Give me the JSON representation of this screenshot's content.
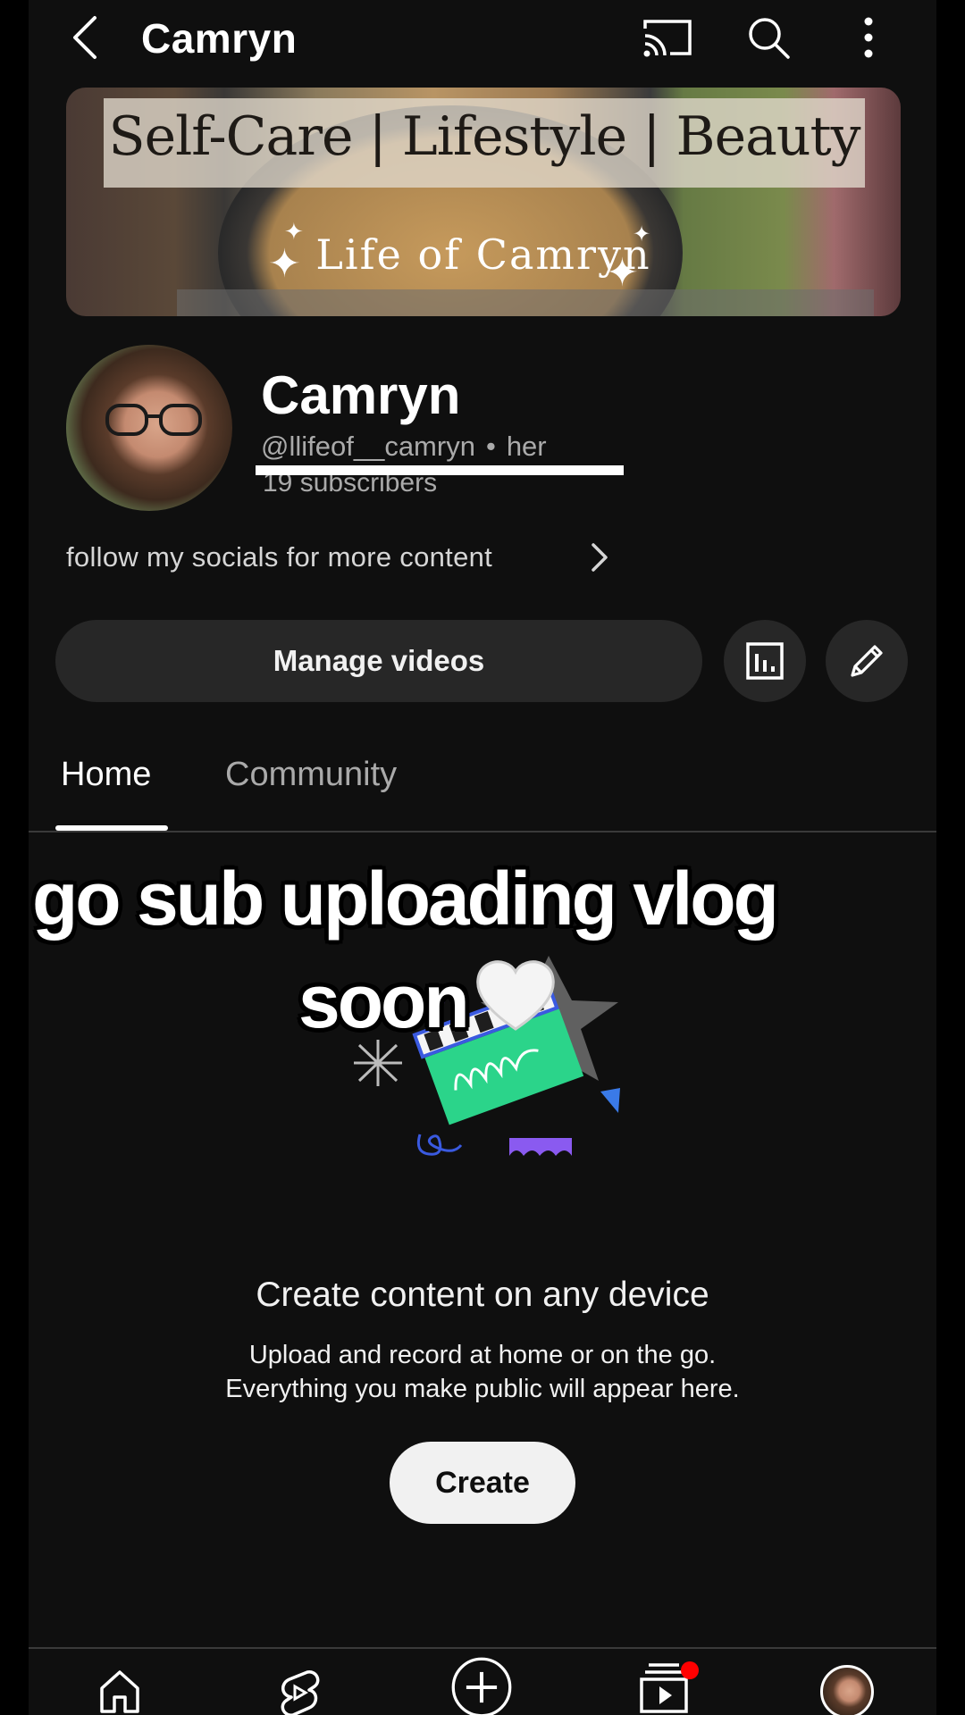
{
  "topbar": {
    "title": "Camryn",
    "back_icon": "chevron-left-icon",
    "cast_icon": "cast-icon",
    "search_icon": "search-icon",
    "more_icon": "more-vert-icon"
  },
  "banner": {
    "tagline": "Self-Care | Lifestyle | Beauty",
    "brand": "Life of Camryn"
  },
  "channel": {
    "name": "Camryn",
    "handle": "@llifeof__camryn",
    "separator": "•",
    "pronouns": "her",
    "subscribers": "19 subscribers",
    "about": "follow my socials for more content"
  },
  "actions": {
    "manage_videos": "Manage videos",
    "stats_icon": "analytics-icon",
    "edit_icon": "pencil-icon"
  },
  "tabs": [
    {
      "label": "Home",
      "selected": true
    },
    {
      "label": "Community",
      "selected": false
    }
  ],
  "overlay": {
    "line1": "go sub uploading vlog",
    "line2": "soon",
    "emoji": "white-heart"
  },
  "empty_state": {
    "title": "Create content on any device",
    "line1": "Upload and record at home or on the go.",
    "line2": "Everything you make public will appear here.",
    "button": "Create"
  },
  "bottom_nav": [
    "home-icon",
    "shorts-icon",
    "create-icon",
    "subscriptions-icon",
    "you-avatar"
  ],
  "colors": {
    "background": "#0f0f0f",
    "surface": "#272727",
    "text": "#f1f1f1",
    "secondary_text": "#aaaaaa",
    "notification_dot": "#ff0000"
  }
}
